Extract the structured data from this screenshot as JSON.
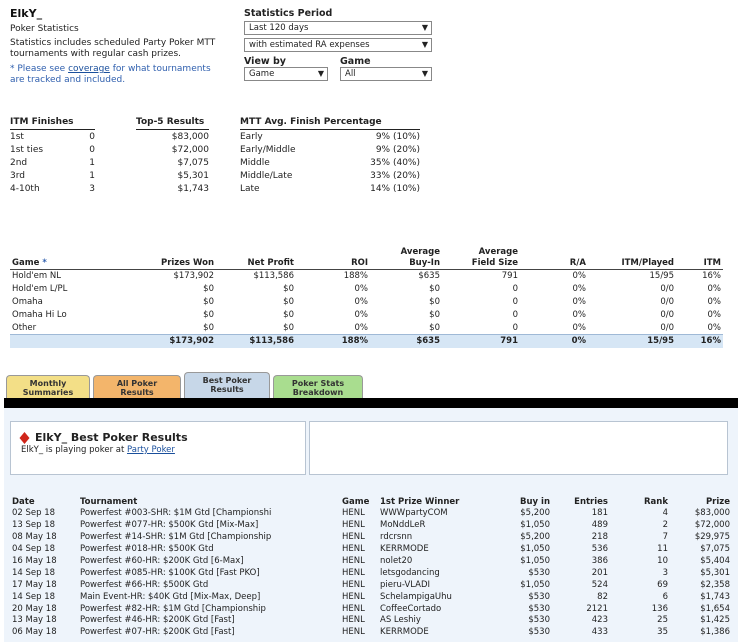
{
  "player": {
    "name": "ElkY_",
    "subtitle": "Poker Statistics",
    "desc_line1": "Statistics includes scheduled Party Poker MTT",
    "desc_line2": "tournaments with regular cash prizes.",
    "note_prefix": "* Please see ",
    "note_link": "coverage",
    "note_suffix": " for what tournaments",
    "note_line2": "are tracked and included."
  },
  "filters": {
    "period_label": "Statistics Period",
    "period_value": "Last 120 days",
    "expenses_value": "with estimated RA expenses",
    "viewby_label": "View by",
    "viewby_value": "Game",
    "game_label": "Game",
    "game_value": "All"
  },
  "itm": {
    "header": "ITM Finishes",
    "rows": [
      {
        "label": "1st",
        "value": "0"
      },
      {
        "label": "1st ties",
        "value": "0"
      },
      {
        "label": "2nd",
        "value": "1"
      },
      {
        "label": "3rd",
        "value": "1"
      },
      {
        "label": "4-10th",
        "value": "3"
      }
    ]
  },
  "top5": {
    "header": "Top-5 Results",
    "values": [
      "$83,000",
      "$72,000",
      "$7,075",
      "$5,301",
      "$1,743"
    ]
  },
  "mtt": {
    "header": "MTT Avg. Finish Percentage",
    "rows": [
      {
        "label": "Early",
        "value": "9% (10%)"
      },
      {
        "label": "Early/Middle",
        "value": "9% (20%)"
      },
      {
        "label": "Middle",
        "value": "35% (40%)"
      },
      {
        "label": "Middle/Late",
        "value": "33% (20%)"
      },
      {
        "label": "Late",
        "value": "14% (10%)"
      }
    ]
  },
  "games": {
    "headers": {
      "game": "Game",
      "game_marker": "*",
      "prizes": "Prizes Won",
      "net": "Net Profit",
      "roi": "ROI",
      "buyin_1": "Average",
      "buyin_2": "Buy-In",
      "field_1": "Average",
      "field_2": "Field Size",
      "ra": "R/A",
      "itm_played": "ITM/Played",
      "itm": "ITM"
    },
    "rows": [
      {
        "game": "Hold'em NL",
        "prizes": "$173,902",
        "net": "$113,586",
        "roi": "188%",
        "buyin": "$635",
        "field": "791",
        "ra": "0%",
        "itmp": "15/95",
        "itm": "16%"
      },
      {
        "game": "Hold'em L/PL",
        "prizes": "$0",
        "net": "$0",
        "roi": "0%",
        "buyin": "$0",
        "field": "0",
        "ra": "0%",
        "itmp": "0/0",
        "itm": "0%"
      },
      {
        "game": "Omaha",
        "prizes": "$0",
        "net": "$0",
        "roi": "0%",
        "buyin": "$0",
        "field": "0",
        "ra": "0%",
        "itmp": "0/0",
        "itm": "0%"
      },
      {
        "game": "Omaha Hi Lo",
        "prizes": "$0",
        "net": "$0",
        "roi": "0%",
        "buyin": "$0",
        "field": "0",
        "ra": "0%",
        "itmp": "0/0",
        "itm": "0%"
      },
      {
        "game": "Other",
        "prizes": "$0",
        "net": "$0",
        "roi": "0%",
        "buyin": "$0",
        "field": "0",
        "ra": "0%",
        "itmp": "0/0",
        "itm": "0%"
      }
    ],
    "total": {
      "game": "",
      "prizes": "$173,902",
      "net": "$113,586",
      "roi": "188%",
      "buyin": "$635",
      "field": "791",
      "ra": "0%",
      "itmp": "15/95",
      "itm": "16%"
    }
  },
  "tabs": [
    {
      "line1": "Monthly",
      "line2": "Summaries",
      "color": "#f3df87"
    },
    {
      "line1": "All Poker",
      "line2": "Results",
      "color": "#f3b56b"
    },
    {
      "line1": "Best Poker",
      "line2": "Results",
      "color": "#c7d7e8"
    },
    {
      "line1": "Poker Stats",
      "line2": "Breakdown",
      "color": "#a9dd8f"
    }
  ],
  "best": {
    "title": "ElkY_ Best Poker Results",
    "sub_prefix": "ElkY_ is playing poker at ",
    "sub_link": "Party Poker",
    "icon": "diamond-suit-icon",
    "icon_color": "#d0261a"
  },
  "results": {
    "headers": {
      "date": "Date",
      "tournament": "Tournament",
      "game": "Game",
      "winner": "1st Prize Winner",
      "buyin": "Buy in",
      "entries": "Entries",
      "rank": "Rank",
      "prize": "Prize"
    },
    "rows": [
      {
        "date": "02 Sep 18",
        "tournament": "Powerfest #003-SHR: $1M Gtd [Championshi",
        "game": "HENL",
        "winner": "WWWpartyCOM",
        "buyin": "$5,200",
        "entries": "181",
        "rank": "4",
        "prize": "$83,000"
      },
      {
        "date": "13 Sep 18",
        "tournament": "Powerfest #077-HR: $500K Gtd [Mix-Max]",
        "game": "HENL",
        "winner": "MoNddLeR",
        "buyin": "$1,050",
        "entries": "489",
        "rank": "2",
        "prize": "$72,000"
      },
      {
        "date": "08 May 18",
        "tournament": "Powerfest #14-SHR: $1M Gtd [Championship",
        "game": "HENL",
        "winner": "rdcrsnn",
        "buyin": "$5,200",
        "entries": "218",
        "rank": "7",
        "prize": "$29,975"
      },
      {
        "date": "04 Sep 18",
        "tournament": "Powerfest #018-HR: $500K Gtd",
        "game": "HENL",
        "winner": "KERRMODE",
        "buyin": "$1,050",
        "entries": "536",
        "rank": "11",
        "prize": "$7,075"
      },
      {
        "date": "16 May 18",
        "tournament": "Powerfest #60-HR: $200K Gtd [6-Max]",
        "game": "HENL",
        "winner": "nolet20",
        "buyin": "$1,050",
        "entries": "386",
        "rank": "10",
        "prize": "$5,404"
      },
      {
        "date": "14 Sep 18",
        "tournament": "Powerfest #085-HR: $100K Gtd [Fast PKO]",
        "game": "HENL",
        "winner": "letsgodancing",
        "buyin": "$530",
        "entries": "201",
        "rank": "3",
        "prize": "$5,301"
      },
      {
        "date": "17 May 18",
        "tournament": "Powerfest #66-HR: $500K Gtd",
        "game": "HENL",
        "winner": "pieru-VLADI",
        "buyin": "$1,050",
        "entries": "524",
        "rank": "69",
        "prize": "$2,358"
      },
      {
        "date": "14 Sep 18",
        "tournament": "Main Event-HR: $40K Gtd [Mix-Max, Deep]",
        "game": "HENL",
        "winner": "SchelampigaUhu",
        "buyin": "$530",
        "entries": "82",
        "rank": "6",
        "prize": "$1,743"
      },
      {
        "date": "20 May 18",
        "tournament": "Powerfest #82-HR: $1M Gtd [Championship",
        "game": "HENL",
        "winner": "CoffeeCortado",
        "buyin": "$530",
        "entries": "2121",
        "rank": "136",
        "prize": "$1,654"
      },
      {
        "date": "13 May 18",
        "tournament": "Powerfest #46-HR: $200K Gtd [Fast]",
        "game": "HENL",
        "winner": "AS Leshiy",
        "buyin": "$530",
        "entries": "423",
        "rank": "25",
        "prize": "$1,425"
      },
      {
        "date": "06 May 18",
        "tournament": "Powerfest #07-HR: $200K Gtd [Fast]",
        "game": "HENL",
        "winner": "KERRMODE",
        "buyin": "$530",
        "entries": "433",
        "rank": "35",
        "prize": "$1,386"
      }
    ]
  }
}
